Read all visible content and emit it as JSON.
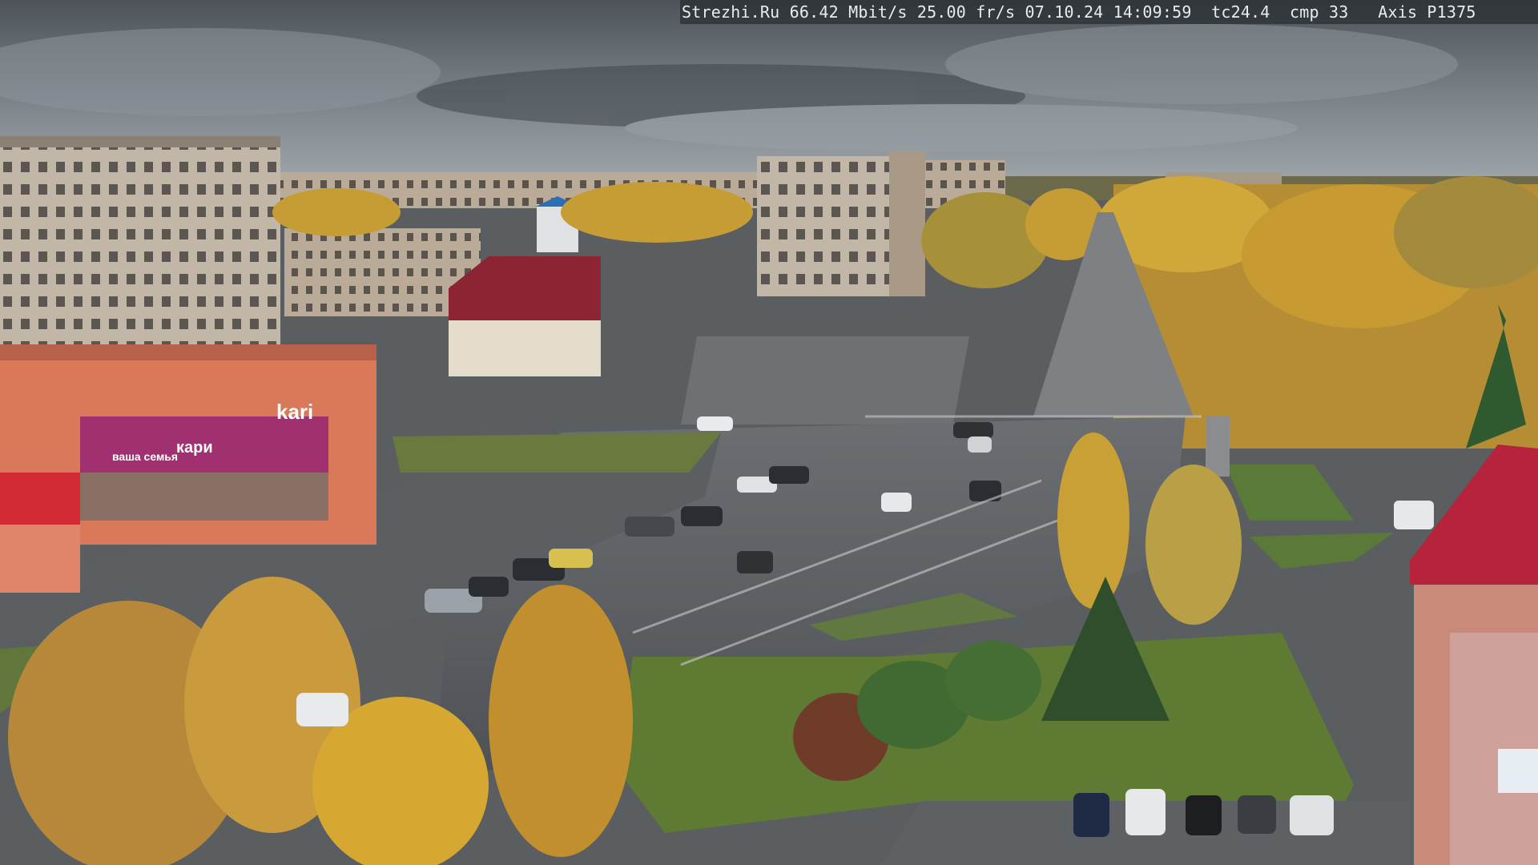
{
  "camera_overlay": {
    "site": "Strezhi.Ru",
    "bitrate": "66.42 Mbit/s",
    "framerate": "25.00 fr/s",
    "datetime": "07.10.24 14:09:59",
    "temperature": "tc24.4",
    "compression": "cmp 33",
    "camera_model": "Axis P1375"
  },
  "signs": {
    "store_logo": "kari",
    "store_banner": "кари",
    "store_tagline": "ваша семья"
  },
  "colors": {
    "sky": "#5f666c",
    "asphalt": "#55595c",
    "foliage": "#c9a23a",
    "grass": "#5f7a3a",
    "kari_magenta": "#9a2a6e",
    "roof_red": "#b5243a"
  }
}
